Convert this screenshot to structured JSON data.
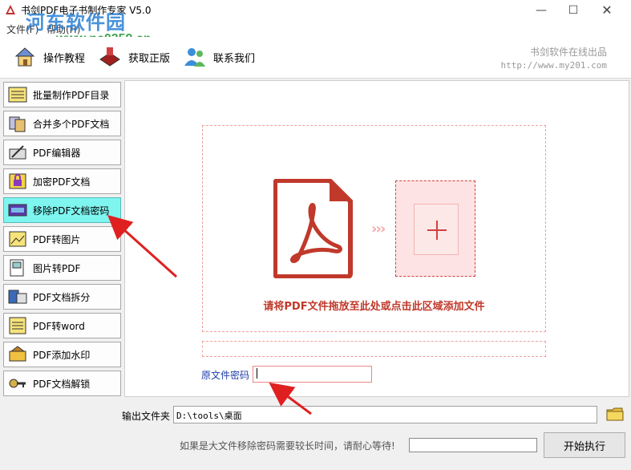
{
  "window": {
    "title": "书剑PDF电子书制作专家 V5.0",
    "minimize": "—",
    "maximize": "☐",
    "close": "✕"
  },
  "watermark": {
    "text": "河东软件园",
    "url": "www.pc0359.cn"
  },
  "menu": [
    {
      "label": "文件(F)"
    },
    {
      "label": "帮助(H)"
    }
  ],
  "toolbar": {
    "items": [
      {
        "label": "操作教程",
        "icon": "tutorial-icon"
      },
      {
        "label": "获取正版",
        "icon": "purchase-icon"
      },
      {
        "label": "联系我们",
        "icon": "contact-icon"
      }
    ],
    "brand_name": "书剑软件在线出品",
    "brand_url": "http://www.my201.com"
  },
  "sidebar": {
    "items": [
      {
        "label": "批量制作PDF目录",
        "icon": "toc-icon",
        "active": false
      },
      {
        "label": "合并多个PDF文档",
        "icon": "merge-icon",
        "active": false
      },
      {
        "label": "PDF编辑器",
        "icon": "editor-icon",
        "active": false
      },
      {
        "label": "加密PDF文档",
        "icon": "encrypt-icon",
        "active": false
      },
      {
        "label": "移除PDF文档密码",
        "icon": "remove-password-icon",
        "active": true
      },
      {
        "label": "PDF转图片",
        "icon": "pdf-to-image-icon",
        "active": false
      },
      {
        "label": "图片转PDF",
        "icon": "image-to-pdf-icon",
        "active": false
      },
      {
        "label": "PDF文档拆分",
        "icon": "split-icon",
        "active": false
      },
      {
        "label": "PDF转word",
        "icon": "pdf-to-word-icon",
        "active": false
      },
      {
        "label": "PDF添加水印",
        "icon": "watermark-icon",
        "active": false
      },
      {
        "label": "PDF文档解锁",
        "icon": "unlock-icon",
        "active": false
      }
    ]
  },
  "main": {
    "chevrons": "›››",
    "drop_hint": "请将PDF文件拖放至此处或点击此区域添加文件",
    "password_label": "原文件密码",
    "password_value": ""
  },
  "footer": {
    "output_label": "输出文件夹",
    "output_value": "D:\\tools\\桌面",
    "notice": "如果是大文件移除密码需要较长时间，请耐心等待!",
    "progress": 0,
    "start_label": "开始执行"
  },
  "colors": {
    "accent_red": "#c0392b",
    "active_item": "#7ff5ef",
    "annotation_arrow": "#e02020"
  }
}
